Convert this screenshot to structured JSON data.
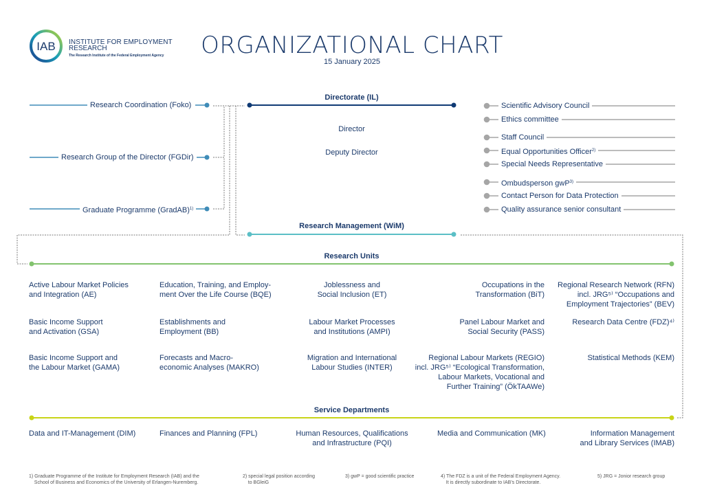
{
  "logo": {
    "mark": "IAB",
    "name_line1": "INSTITUTE FOR EMPLOYMENT",
    "name_line2": "RESEARCH",
    "tagline": "The Research Institute of the Federal Employment Agency"
  },
  "header": {
    "title": "ORGANIZATIONAL CHART",
    "date": "15 January 2025"
  },
  "colors": {
    "text": "#1b3a6b",
    "directorate": "#0f3a74",
    "staff_units": "#3f8cb8",
    "research_management": "#5bbfc6",
    "research_units": "#82c36e",
    "service_departments": "#c8d417",
    "committees": "#a6a6a6"
  },
  "staff_units": [
    {
      "label": "Research Coordination (Foko)",
      "sup": ""
    },
    {
      "label": "Research Group of the Director (FGDir)",
      "sup": ""
    },
    {
      "label": "Graduate Programme (GradAB)",
      "sup": "1)"
    }
  ],
  "directorate": {
    "heading": "Directorate (IL)",
    "members": [
      "Director",
      "Deputy Director"
    ]
  },
  "committees": [
    {
      "label": "Scientific Advisory Council",
      "sup": ""
    },
    {
      "label": "Ethics committee",
      "sup": ""
    },
    {
      "label": "Staff Council",
      "sup": ""
    },
    {
      "label": "Equal Opportunities Officer",
      "sup": "2)"
    },
    {
      "label": "Special Needs Representative",
      "sup": ""
    },
    {
      "label": "Ombudsperson gwP",
      "sup": "3)"
    },
    {
      "label": "Contact Person for Data Protection",
      "sup": ""
    },
    {
      "label": "Quality assurance senior consultant",
      "sup": ""
    }
  ],
  "research_management": {
    "heading": "Research Management (WiM)"
  },
  "research_units": {
    "heading": "Research Units",
    "columns": [
      [
        {
          "lines": [
            "Active Labour Market Policies",
            "and Integration (AE)"
          ]
        },
        {
          "lines": [
            "Basic Income Support",
            "and Activation (GSA)"
          ]
        },
        {
          "lines": [
            "Basic Income Support and",
            "the Labour Market (GAMA)"
          ]
        }
      ],
      [
        {
          "lines": [
            "Education, Training, and Employ-",
            "ment Over the Life Course (BQE)"
          ]
        },
        {
          "lines": [
            "Establishments and",
            "Employment (BB)"
          ]
        },
        {
          "lines": [
            "Forecasts and Macro-",
            "economic Analyses (MAKRO)"
          ]
        }
      ],
      [
        {
          "lines": [
            "Joblessness and",
            "Social Inclusion (ET)"
          ]
        },
        {
          "lines": [
            "Labour Market Processes",
            "and Institutions (AMPI)"
          ]
        },
        {
          "lines": [
            "Migration and International",
            "Labour Studies (INTER)"
          ]
        }
      ],
      [
        {
          "lines": [
            "Occupations in the",
            "Transformation (BiT)"
          ]
        },
        {
          "lines": [
            "Panel Labour Market and",
            "Social Security (PASS)"
          ]
        },
        {
          "lines": [
            "Regional Labour Markets (REGIO)",
            "incl. JRG⁵⁾ “Ecological Transformation,",
            "Labour Markets, Vocational and",
            "Further Training” (ÖkTAAWe)"
          ]
        }
      ],
      [
        {
          "lines": [
            "Regional Research Network (RFN)",
            "incl. JRG⁵⁾ “Occupations and",
            "Employment Trajectories” (BEV)"
          ]
        },
        {
          "lines": [
            "Research Data Centre (FDZ)⁴⁾"
          ]
        },
        {
          "lines": [
            "Statistical Methods (KEM)"
          ]
        }
      ]
    ]
  },
  "service_departments": {
    "heading": "Service Departments",
    "items": [
      {
        "lines": [
          "Data and IT-Management (DIM)"
        ]
      },
      {
        "lines": [
          "Finances and Planning (FPL)"
        ]
      },
      {
        "lines": [
          "Human Resources, Qualifications",
          "and Infrastructure (PQI)"
        ]
      },
      {
        "lines": [
          "Media and Communication (MK)"
        ]
      },
      {
        "lines": [
          "Information Management",
          "and Library Services (IMAB)"
        ]
      }
    ]
  },
  "footnotes": [
    {
      "lines": [
        "1) Graduate Programme of the Institute for Employment Research (IAB) and the",
        "    School of Business and Economics of the University of Erlangen-Nuremberg."
      ]
    },
    {
      "lines": [
        "2) special legal position according",
        "    to BGleiG"
      ]
    },
    {
      "lines": [
        "3) gwP = good scientific practice"
      ]
    },
    {
      "lines": [
        "4) The FDZ is a unit of the Federal Employment Agency.",
        "    It is directly subordinate to IAB’s Directorate."
      ]
    },
    {
      "lines": [
        "5) JRG = Jonior research group"
      ]
    }
  ]
}
